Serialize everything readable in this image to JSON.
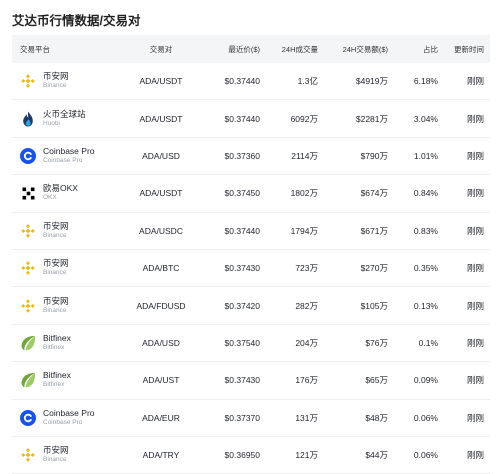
{
  "page": {
    "title": "艾达币行情数据/交易对"
  },
  "table": {
    "headers": {
      "exchange": "交易平台",
      "pair": "交易对",
      "price": "最近价($)",
      "vol24": "24H成交量",
      "amount24": "24H交易额($)",
      "share": "占比",
      "updated": "更新时间"
    },
    "rows": [
      {
        "name": "币安网",
        "sub": "Binance",
        "icon": "binance-icon",
        "pair": "ADA/USDT",
        "price": "$0.37440",
        "vol": "1.3亿",
        "amt": "$4919万",
        "share": "6.18%",
        "time": "刚刚"
      },
      {
        "name": "火币全球站",
        "sub": "Huobi",
        "icon": "huobi-icon",
        "pair": "ADA/USDT",
        "price": "$0.37440",
        "vol": "6092万",
        "amt": "$2281万",
        "share": "3.04%",
        "time": "刚刚"
      },
      {
        "name": "Coinbase Pro",
        "sub": "Coinbase Pro",
        "icon": "coinbase-icon",
        "pair": "ADA/USD",
        "price": "$0.37360",
        "vol": "2114万",
        "amt": "$790万",
        "share": "1.01%",
        "time": "刚刚"
      },
      {
        "name": "欧易OKX",
        "sub": "OKX",
        "icon": "okx-icon",
        "pair": "ADA/USDT",
        "price": "$0.37450",
        "vol": "1802万",
        "amt": "$674万",
        "share": "0.84%",
        "time": "刚刚"
      },
      {
        "name": "币安网",
        "sub": "Binance",
        "icon": "binance-icon",
        "pair": "ADA/USDC",
        "price": "$0.37440",
        "vol": "1794万",
        "amt": "$671万",
        "share": "0.83%",
        "time": "刚刚"
      },
      {
        "name": "币安网",
        "sub": "Binance",
        "icon": "binance-icon",
        "pair": "ADA/BTC",
        "price": "$0.37430",
        "vol": "723万",
        "amt": "$270万",
        "share": "0.35%",
        "time": "刚刚"
      },
      {
        "name": "币安网",
        "sub": "Binance",
        "icon": "binance-icon",
        "pair": "ADA/FDUSD",
        "price": "$0.37420",
        "vol": "282万",
        "amt": "$105万",
        "share": "0.13%",
        "time": "刚刚"
      },
      {
        "name": "Bitfinex",
        "sub": "Bitfinex",
        "icon": "bitfinex-icon",
        "pair": "ADA/USD",
        "price": "$0.37540",
        "vol": "204万",
        "amt": "$76万",
        "share": "0.1%",
        "time": "刚刚"
      },
      {
        "name": "Bitfinex",
        "sub": "Bitfinex",
        "icon": "bitfinex-icon",
        "pair": "ADA/UST",
        "price": "$0.37430",
        "vol": "176万",
        "amt": "$65万",
        "share": "0.09%",
        "time": "刚刚"
      },
      {
        "name": "Coinbase Pro",
        "sub": "Coinbase Pro",
        "icon": "coinbase-icon",
        "pair": "ADA/EUR",
        "price": "$0.37370",
        "vol": "131万",
        "amt": "$48万",
        "share": "0.06%",
        "time": "刚刚"
      },
      {
        "name": "币安网",
        "sub": "Binance",
        "icon": "binance-icon",
        "pair": "ADA/TRY",
        "price": "$0.36950",
        "vol": "121万",
        "amt": "$44万",
        "share": "0.06%",
        "time": "刚刚"
      }
    ]
  },
  "colors": {
    "binance": "#F0B90B",
    "huobi": "#1B3A6B",
    "huobi_flame": "#2CA6E0",
    "coinbase": "#1652F0",
    "okx": "#000000",
    "bitfinex": "#6FA839"
  }
}
